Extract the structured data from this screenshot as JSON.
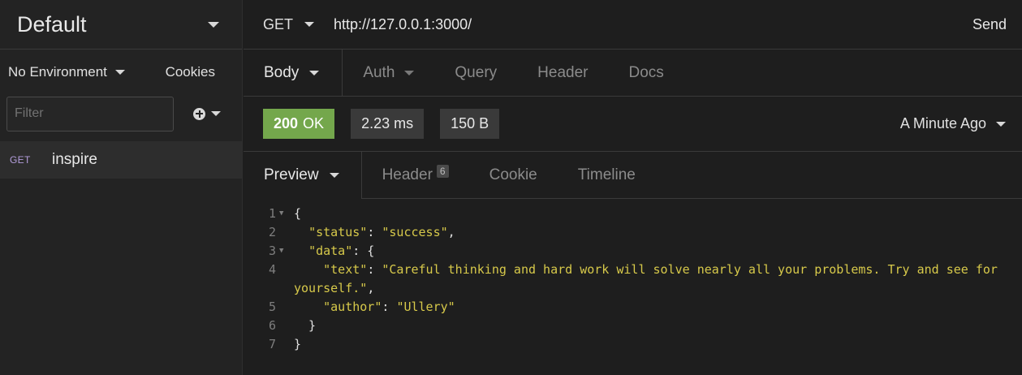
{
  "sidebar": {
    "workspace": "Default",
    "environment": "No Environment",
    "cookies": "Cookies",
    "filter_placeholder": "Filter",
    "requests": [
      {
        "method": "GET",
        "name": "inspire"
      }
    ]
  },
  "request": {
    "method": "GET",
    "url": "http://127.0.0.1:3000/",
    "send_label": "Send",
    "tabs": [
      "Body",
      "Auth",
      "Query",
      "Header",
      "Docs"
    ]
  },
  "response": {
    "status_code": "200",
    "status_text": "OK",
    "time": "2.23 ms",
    "size": "150 B",
    "time_ago": "A Minute Ago",
    "tabs": {
      "preview": "Preview",
      "header": "Header",
      "header_count": "6",
      "cookie": "Cookie",
      "timeline": "Timeline"
    },
    "body": {
      "status_key": "\"status\"",
      "status_value": "\"success\"",
      "data_key": "\"data\"",
      "text_key": "\"text\"",
      "text_value": "\"Careful thinking and hard work will solve nearly all your problems. Try and see for yourself.\"",
      "author_key": "\"author\"",
      "author_value": "\"Ullery\""
    }
  },
  "colors": {
    "accent_ok": "#74a74c",
    "json_string": "#d7c94a",
    "method_get": "#b39ddb"
  }
}
